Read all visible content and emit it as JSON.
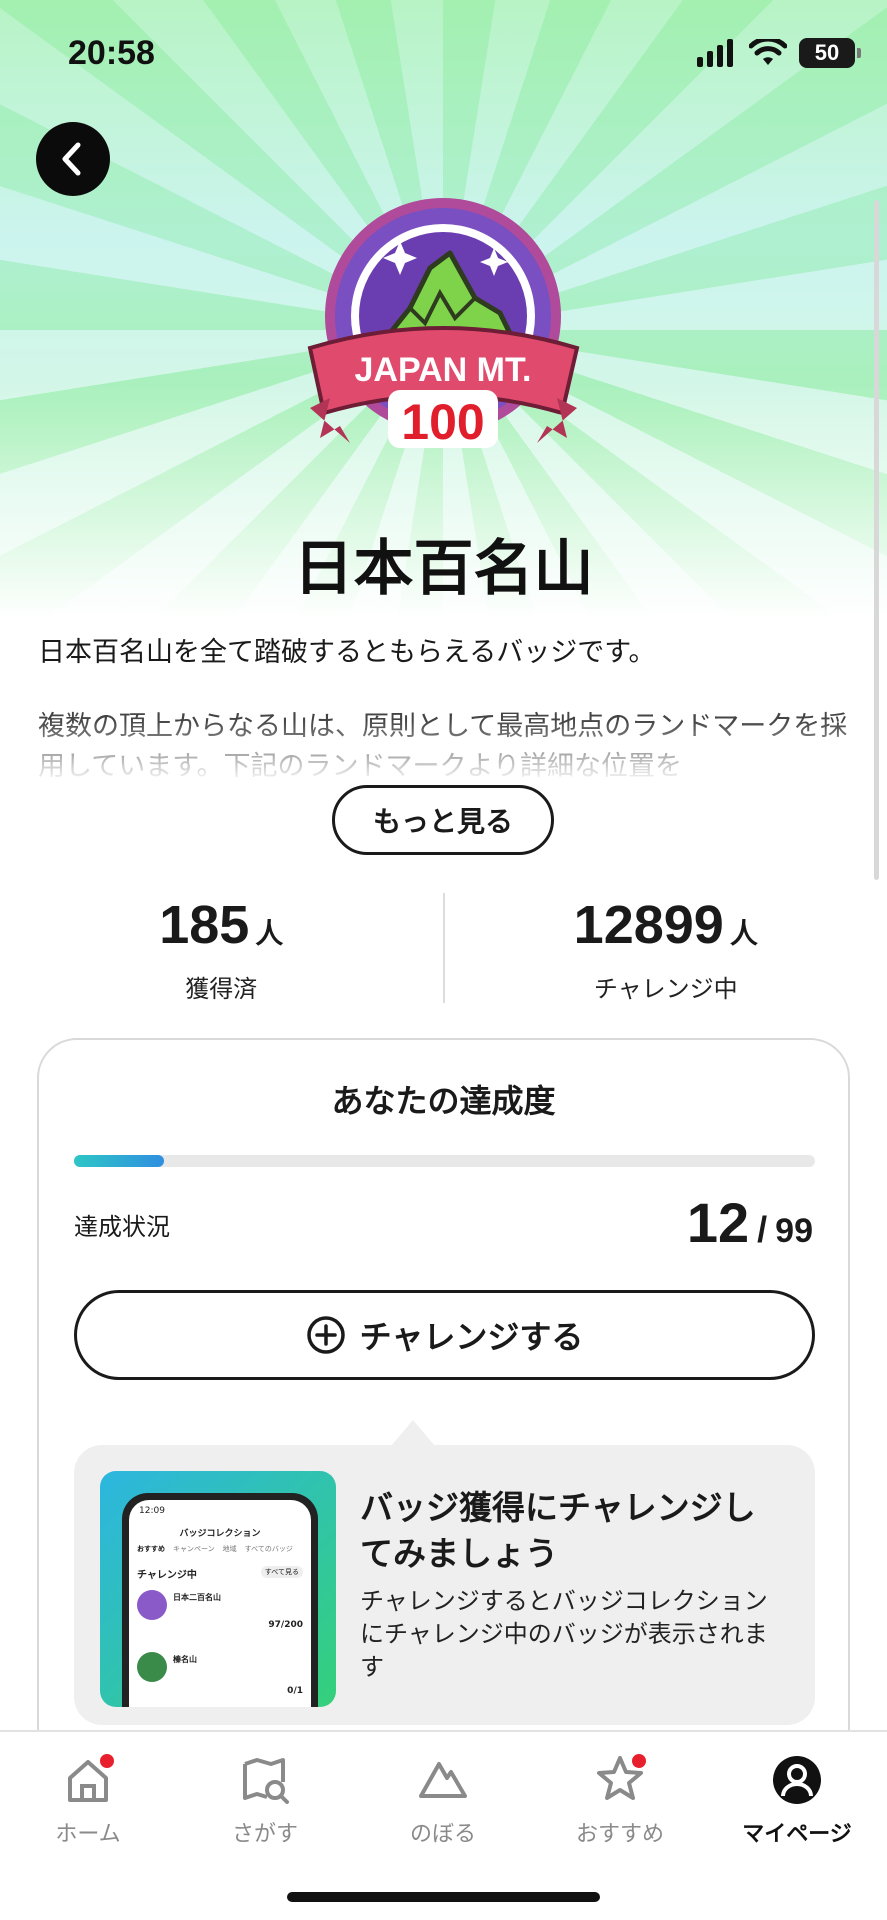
{
  "status_bar": {
    "time": "20:58",
    "battery": "50"
  },
  "badge": {
    "icon": "japan-mt-100-badge",
    "text_top": "JAPAN MT.",
    "text_bottom": "100",
    "colors": {
      "ring": "#7a4fc2",
      "mountain": "#7fd34b",
      "ribbon": "#e04a6c",
      "number": "#e01e2c"
    }
  },
  "title": "日本百名山",
  "description": {
    "line1": "日本百名山を全て踏破するともらえるバッジです。",
    "line2": "複数の頂上からなる山は、原則として最高地点のランドマークを採用しています。下記のランドマークより詳細な位置を"
  },
  "more_button": "もっと見る",
  "stats": [
    {
      "value": "185",
      "unit": "人",
      "label": "獲得済"
    },
    {
      "value": "12899",
      "unit": "人",
      "label": "チャレンジ中"
    }
  ],
  "achievement": {
    "title": "あなたの達成度",
    "progress": 0.121,
    "status_label": "達成状況",
    "current": "12",
    "separator": "/",
    "total": "99",
    "challenge_button": "チャレンジする"
  },
  "tip": {
    "title": "バッジ獲得にチャレンジしてみましょう",
    "body": "チャレンジするとバッジコレクションにチャレンジ中のバッジが表示されます",
    "preview": {
      "time": "12:09",
      "screen_title": "バッジコレクション",
      "tabs": [
        "おすすめ",
        "キャンペーン",
        "地域",
        "すべてのバッジ"
      ],
      "section": "チャレンジ中",
      "see_all": "すべて見る",
      "items": [
        {
          "name": "日本二百名山",
          "count": "97",
          "total": "200"
        },
        {
          "name": "榛名山",
          "count": "0",
          "total": "1"
        }
      ]
    }
  },
  "tabbar": [
    {
      "label": "ホーム",
      "icon": "home-icon",
      "dot": true
    },
    {
      "label": "さがす",
      "icon": "map-search-icon",
      "dot": false
    },
    {
      "label": "のぼる",
      "icon": "mountain-icon",
      "dot": false
    },
    {
      "label": "おすすめ",
      "icon": "star-icon",
      "dot": true
    },
    {
      "label": "マイページ",
      "icon": "user-icon",
      "dot": false,
      "active": true
    }
  ]
}
